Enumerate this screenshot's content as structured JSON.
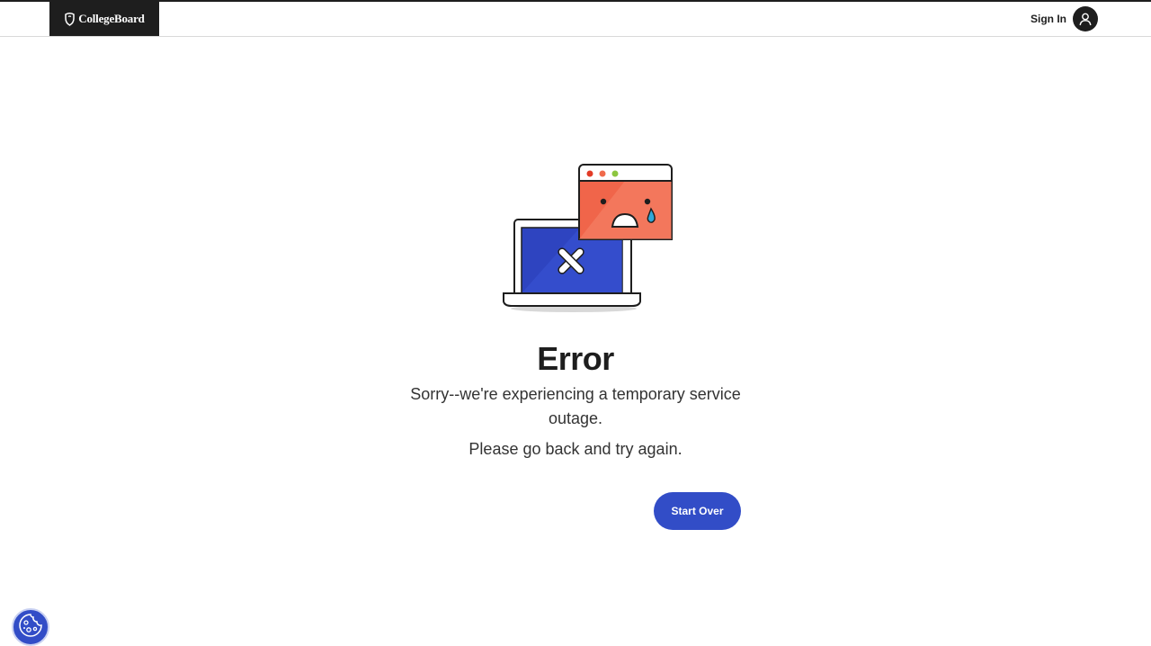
{
  "header": {
    "logo_text": "CollegeBoard",
    "sign_in_label": "Sign In"
  },
  "main": {
    "title": "Error",
    "message": "Sorry--we're experiencing a temporary service outage.",
    "submessage": "Please go back and try again.",
    "start_over_label": "Start Over"
  },
  "icons": {
    "logo": "acorn-icon",
    "avatar": "user-icon",
    "illustration": "error-laptop-illustration",
    "cookie": "cookie-settings-icon"
  },
  "colors": {
    "brand_dark": "#1e1e1e",
    "accent_blue": "#324dc7",
    "laptop_screen": "#2e44c0",
    "window_red": "#f0654a"
  }
}
